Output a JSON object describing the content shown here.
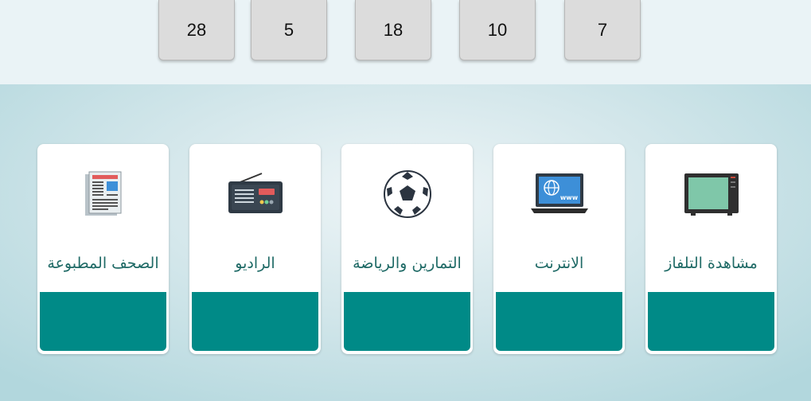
{
  "number_tiles": [
    "28",
    "5",
    "18",
    "10",
    "7"
  ],
  "cards": [
    {
      "id": "tv",
      "label": "مشاهدة التلفاز",
      "icon": "tv-icon"
    },
    {
      "id": "internet",
      "label": "الانترنت",
      "icon": "laptop-www-icon"
    },
    {
      "id": "sports",
      "label": "التمارين والرياضة",
      "icon": "soccer-ball-icon"
    },
    {
      "id": "radio",
      "label": "الراديو",
      "icon": "radio-icon"
    },
    {
      "id": "newspapers",
      "label": "الصحف المطبوعة",
      "icon": "newspaper-icon"
    }
  ],
  "colors": {
    "drop_zone": "#008a87",
    "label_text": "#1f6a66",
    "tile_background": "#dcdcdc"
  }
}
